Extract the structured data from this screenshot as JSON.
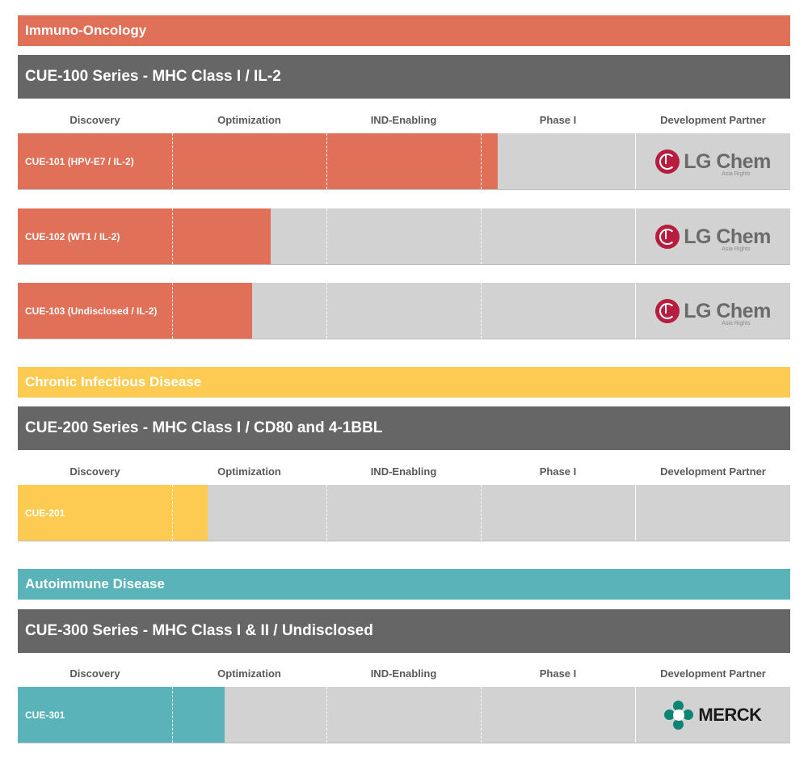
{
  "colors": {
    "immuno": "#e07058",
    "infectious": "#fdcb52",
    "autoimmune": "#5ab3b8",
    "series_band": "#666666",
    "track": "#d2d2d2"
  },
  "stage_headers": [
    "Discovery",
    "Optimization",
    "IND-Enabling",
    "Phase I",
    "Development Partner"
  ],
  "sections": [
    {
      "category": "Immuno-Oncology",
      "series": "CUE-100 Series - MHC Class I / IL-2",
      "programs": [
        {
          "name": "CUE-101 (HPV-E7 / IL-2)",
          "partner": "LG Chem",
          "partner_note": "Asia Rights"
        },
        {
          "name": "CUE-102 (WT1 / IL-2)",
          "partner": "LG Chem",
          "partner_note": "Asia Rights"
        },
        {
          "name": "CUE-103 (Undisclosed / IL-2)",
          "partner": "LG Chem",
          "partner_note": "Asia Rights"
        }
      ]
    },
    {
      "category": "Chronic Infectious Disease",
      "series": "CUE-200 Series - MHC Class I / CD80 and 4-1BBL",
      "programs": [
        {
          "name": "CUE-201",
          "partner": "",
          "partner_note": ""
        }
      ]
    },
    {
      "category": "Autoimmune Disease",
      "series": "CUE-300 Series - MHC Class I & II / Undisclosed",
      "programs": [
        {
          "name": "CUE-301",
          "partner": "MERCK",
          "partner_note": ""
        }
      ]
    }
  ],
  "chart_data": {
    "type": "bar",
    "orientation": "horizontal",
    "stages": [
      "Discovery",
      "Optimization",
      "IND-Enabling",
      "Phase I"
    ],
    "categories": [
      "CUE-101 (HPV-E7 / IL-2)",
      "CUE-102 (WT1 / IL-2)",
      "CUE-103 (Undisclosed / IL-2)",
      "CUE-201",
      "CUE-301"
    ],
    "values": [
      3.11,
      1.64,
      1.52,
      1.23,
      1.34
    ],
    "value_unit": "stages completed (0 = none, 4 = Phase I complete)",
    "xlim": [
      0,
      4
    ]
  }
}
